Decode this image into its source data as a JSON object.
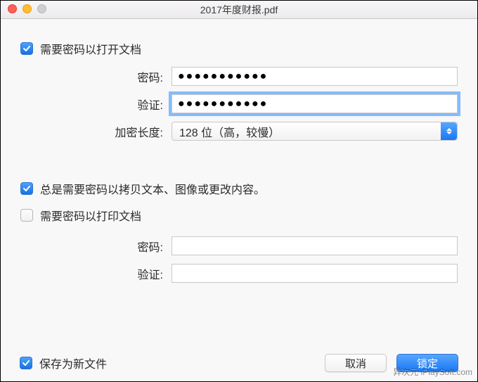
{
  "window": {
    "title": "2017年度财报.pdf"
  },
  "section_open": {
    "require_password_label": "需要密码以打开文档",
    "require_password_checked": true,
    "password_label": "密码:",
    "password_value": "●●●●●●●●●●●",
    "verify_label": "验证:",
    "verify_value": "●●●●●●●●●●●",
    "encryption_label": "加密长度:",
    "encryption_value": "128 位（高，较慢）"
  },
  "section_perm": {
    "always_require_label": "总是需要密码以拷贝文本、图像或更改内容。",
    "always_require_checked": true,
    "require_print_label": "需要密码以打印文档",
    "require_print_checked": false,
    "password_label": "密码:",
    "password_value": "",
    "verify_label": "验证:",
    "verify_value": ""
  },
  "footer": {
    "save_new_label": "保存为新文件",
    "save_new_checked": true,
    "cancel_label": "取消",
    "confirm_label": "锁定"
  },
  "watermark": "异次元 iPlaySoft.com"
}
